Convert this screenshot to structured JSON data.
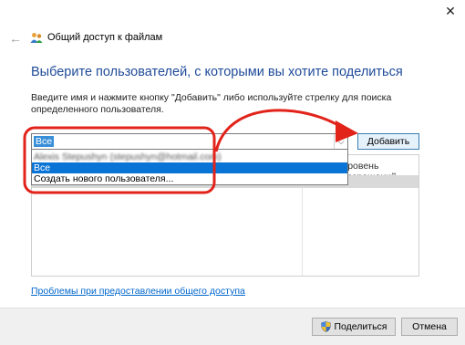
{
  "window": {
    "close_glyph": "✕",
    "back_glyph": "←",
    "title": "Общий доступ к файлам"
  },
  "heading": "Выберите пользователей, с которыми вы хотите поделиться",
  "instructions": "Введите имя и нажмите кнопку \"Добавить\" либо используйте стрелку для поиска определенного пользователя.",
  "combo": {
    "value": "Все",
    "arrow_glyph": "⌵"
  },
  "add_button_label": "Добавить",
  "table": {
    "permission_header": "Уровень разрешений",
    "permission_cell": "Ч"
  },
  "dropdown": {
    "items": [
      "Alexis Stepushyn (stepushyn@hotmail.com)",
      "Все",
      "Создать нового пользователя..."
    ],
    "selected_index": 1
  },
  "help_link": "Проблемы при предоставлении общего доступа",
  "footer": {
    "share_label": "Поделиться",
    "cancel_label": "Отмена"
  },
  "colors": {
    "heading": "#1f4b99",
    "annotation": "#e2231a",
    "selection": "#0a74d6",
    "link": "#0066cc"
  },
  "icons": {
    "title": "share-users-icon",
    "share_button": "uac-shield-icon"
  }
}
